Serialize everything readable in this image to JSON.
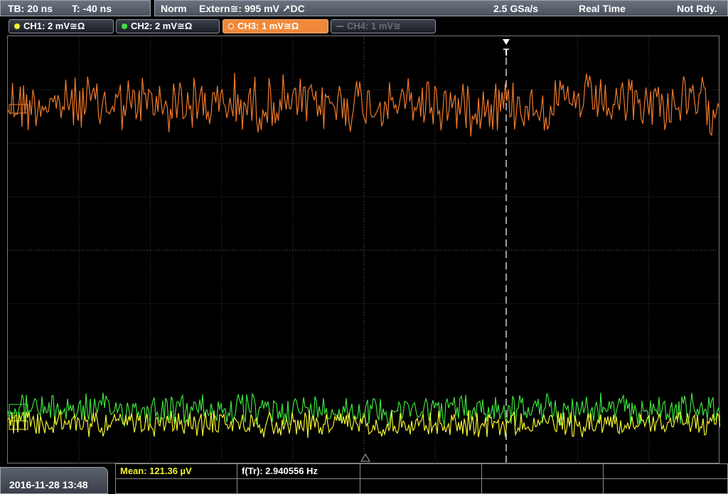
{
  "status": {
    "timebase": "TB: 20 ns",
    "trigger_offset": "T: -40 ns",
    "acq_mode": "Norm",
    "trigger_source": "Extern≅: 995 mV ↗DC",
    "sample_rate": "2.5 GSa/s",
    "sampling": "Real Time",
    "run_state": "Not Rdy."
  },
  "channels": [
    {
      "label": "CH1: 2 mV≅Ω",
      "color": "#f2f230"
    },
    {
      "label": "CH2: 2 mV≅Ω",
      "color": "#3ce03c"
    },
    {
      "label": "CH3: 1 mV≅Ω",
      "color": "#f07a2a"
    },
    {
      "label": "CH4: 1 mV≅",
      "color": "#6a707a"
    }
  ],
  "trigger_marker": "T",
  "measurements": {
    "mean": "Mean: 121.36 µV",
    "frequency": "f(Tr): 2.940556 Hz"
  },
  "datetime": "2016-11-28 13:48",
  "colors": {
    "ch1": "#f2f230",
    "ch2": "#3ce03c",
    "ch3": "#f07a2a",
    "grid": "#3a3a3a",
    "mean_text": "#f2f230"
  }
}
